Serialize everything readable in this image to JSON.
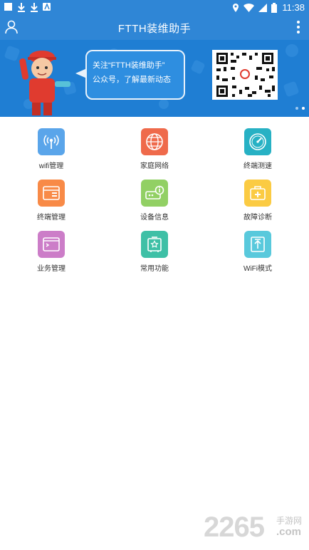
{
  "status_bar": {
    "time": "11:38"
  },
  "app_bar": {
    "title": "FTTH装维助手"
  },
  "banner": {
    "line1": "关注“FTTH装维助手”",
    "line2": "公众号，了解最新动态"
  },
  "grid": [
    {
      "label": "wifi管理",
      "color": "#5aa5ea",
      "icon": "wifi-signal-icon"
    },
    {
      "label": "家庭网络",
      "color": "#ef6a4b",
      "icon": "globe-icon"
    },
    {
      "label": "终端测速",
      "color": "#27b1c4",
      "icon": "speedometer-icon"
    },
    {
      "label": "终端管理",
      "color": "#f88a47",
      "icon": "terminal-window-icon"
    },
    {
      "label": "设备信息",
      "color": "#92d064",
      "icon": "device-info-icon"
    },
    {
      "label": "故障诊断",
      "color": "#fbcb43",
      "icon": "medical-kit-icon"
    },
    {
      "label": "业务管理",
      "color": "#cc7dc8",
      "icon": "console-window-icon"
    },
    {
      "label": "常用功能",
      "color": "#3ec0a6",
      "icon": "star-board-icon"
    },
    {
      "label": "WiFi模式",
      "color": "#59c9dc",
      "icon": "upload-arrow-icon"
    }
  ],
  "watermark": {
    "number": "2265",
    "site": "手游网",
    "domain": ".com"
  }
}
